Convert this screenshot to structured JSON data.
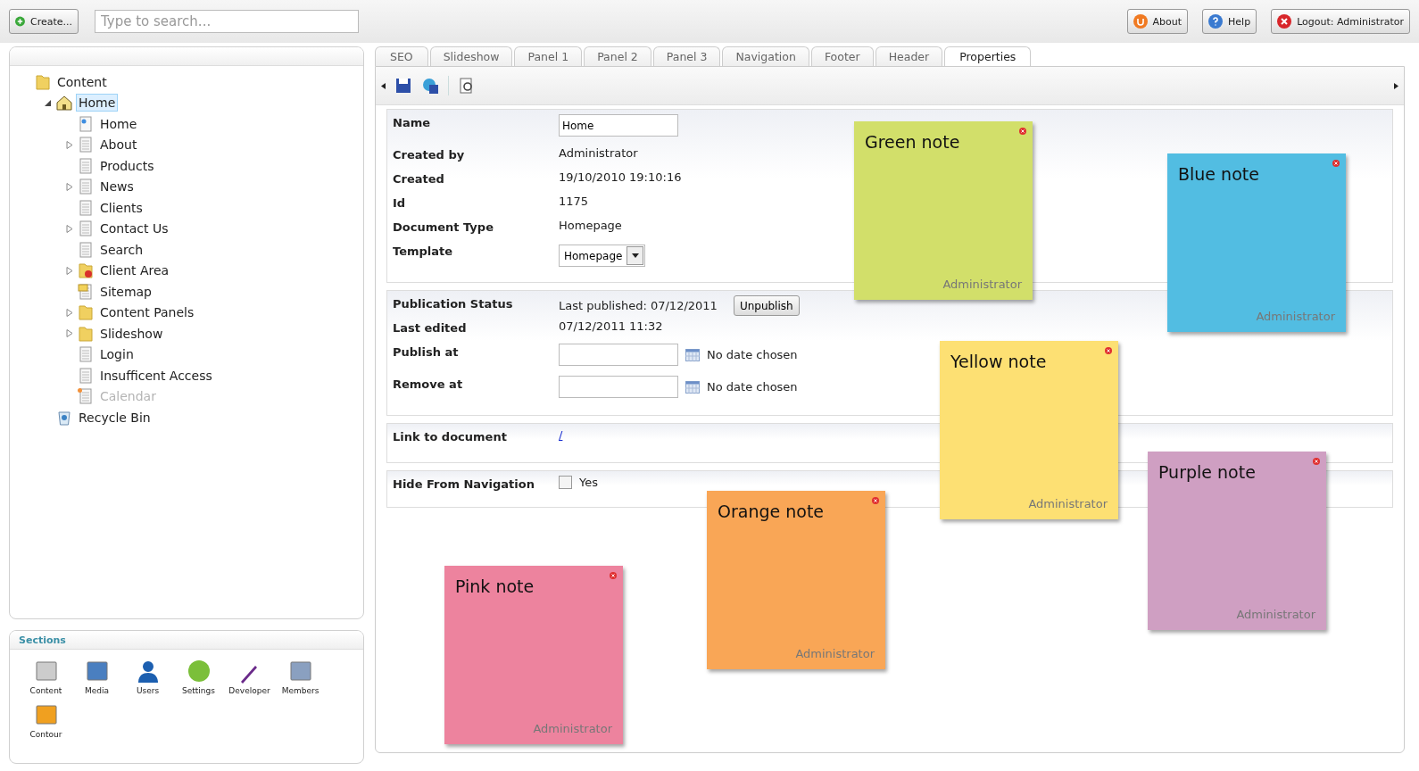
{
  "topbar": {
    "create": "Create...",
    "search": {
      "placeholder": "Type to search..."
    },
    "buttons": [
      {
        "kind": "about",
        "label": "About"
      },
      {
        "kind": "help",
        "label": "Help"
      },
      {
        "kind": "logout",
        "label": "Logout: Administrator"
      }
    ]
  },
  "tree": [
    {
      "label": "Content",
      "kind": "folder",
      "selected": false,
      "disabled": false,
      "children": [
        {
          "label": "Home",
          "kind": "home",
          "selected": true,
          "disabled": false,
          "expanded": true,
          "children": [
            {
              "label": "Home",
              "kind": "doclink",
              "selected": false,
              "disabled": false
            },
            {
              "label": "About",
              "kind": "page",
              "selected": false,
              "disabled": false,
              "expanded": false
            },
            {
              "label": "Products",
              "kind": "page",
              "selected": false,
              "disabled": false
            },
            {
              "label": "News",
              "kind": "page",
              "selected": false,
              "disabled": false,
              "expanded": false
            },
            {
              "label": "Clients",
              "kind": "page",
              "selected": false,
              "disabled": false
            },
            {
              "label": "Contact Us",
              "kind": "page",
              "selected": false,
              "disabled": false,
              "expanded": false
            },
            {
              "label": "Search",
              "kind": "page",
              "selected": false,
              "disabled": false
            },
            {
              "label": "Client Area",
              "kind": "lockedfolder",
              "selected": false,
              "disabled": false,
              "expanded": false
            },
            {
              "label": "Sitemap",
              "kind": "sitemap",
              "selected": false,
              "disabled": false
            },
            {
              "label": "Content Panels",
              "kind": "folder",
              "selected": false,
              "disabled": false,
              "expanded": false
            },
            {
              "label": "Slideshow",
              "kind": "folder",
              "selected": false,
              "disabled": false,
              "expanded": false
            },
            {
              "label": "Login",
              "kind": "page",
              "selected": false,
              "disabled": false
            },
            {
              "label": "Insufficent Access",
              "kind": "page",
              "selected": false,
              "disabled": false
            },
            {
              "label": "Calendar",
              "kind": "newpage",
              "selected": false,
              "disabled": true
            }
          ]
        },
        {
          "label": "Recycle Bin",
          "kind": "recycle",
          "selected": false,
          "disabled": false
        }
      ]
    }
  ],
  "sections": {
    "title": "Sections",
    "items": [
      {
        "kind": "content",
        "label": "Content"
      },
      {
        "kind": "media",
        "label": "Media"
      },
      {
        "kind": "users",
        "label": "Users"
      },
      {
        "kind": "settings",
        "label": "Settings"
      },
      {
        "kind": "developer",
        "label": "Developer"
      },
      {
        "kind": "members",
        "label": "Members"
      },
      {
        "kind": "contour",
        "label": "Contour"
      }
    ]
  },
  "tabs": [
    {
      "label": "SEO",
      "selected": false
    },
    {
      "label": "Slideshow",
      "selected": false
    },
    {
      "label": "Panel 1",
      "selected": false
    },
    {
      "label": "Panel 2",
      "selected": false
    },
    {
      "label": "Panel 3",
      "selected": false
    },
    {
      "label": "Navigation",
      "selected": false
    },
    {
      "label": "Footer",
      "selected": false
    },
    {
      "label": "Header",
      "selected": false
    },
    {
      "label": "Properties",
      "selected": true
    }
  ],
  "toolbar": [
    {
      "kind": "save"
    },
    {
      "kind": "publish"
    },
    {
      "kind": "preview"
    }
  ],
  "groups": [
    {
      "rows": [
        {
          "kind": "input",
          "label": "Name",
          "value": "Home"
        },
        {
          "kind": "text",
          "label": "Created by",
          "value": "Administrator"
        },
        {
          "kind": "text",
          "label": "Created",
          "value": "19/10/2010 19:10:16"
        },
        {
          "kind": "text",
          "label": "Id",
          "value": "1175"
        },
        {
          "kind": "text",
          "label": "Document Type",
          "value": "Homepage"
        },
        {
          "kind": "select",
          "label": "Template",
          "value": "Homepage"
        }
      ]
    },
    {
      "rows": [
        {
          "kind": "published",
          "label": "Publication Status",
          "value": "Last published: 07/12/2011",
          "button": "Unpublish"
        },
        {
          "kind": "text",
          "label": "Last edited",
          "value": "07/12/2011 11:32"
        },
        {
          "kind": "date",
          "label": "Publish at",
          "value": "No date chosen"
        },
        {
          "kind": "date",
          "label": "Remove at",
          "value": "No date chosen"
        }
      ]
    },
    {
      "rows": [
        {
          "kind": "link",
          "label": "Link to document",
          "value": "/"
        }
      ]
    },
    {
      "rows": [
        {
          "kind": "checkbox",
          "label": "Hide From Navigation",
          "value": "Yes",
          "checked": false
        }
      ]
    }
  ],
  "notes": [
    {
      "title": "Green note",
      "author": "Administrator",
      "color": "#d2df6a"
    },
    {
      "title": "Blue note",
      "author": "Administrator",
      "color": "#52bde2"
    },
    {
      "title": "Yellow note",
      "author": "Administrator",
      "color": "#fde073"
    },
    {
      "title": "Purple note",
      "author": "Administrator",
      "color": "#cf9fc2"
    },
    {
      "title": "Orange note",
      "author": "Administrator",
      "color": "#f9a656"
    },
    {
      "title": "Pink note",
      "author": "Administrator",
      "color": "#ed839e"
    }
  ]
}
